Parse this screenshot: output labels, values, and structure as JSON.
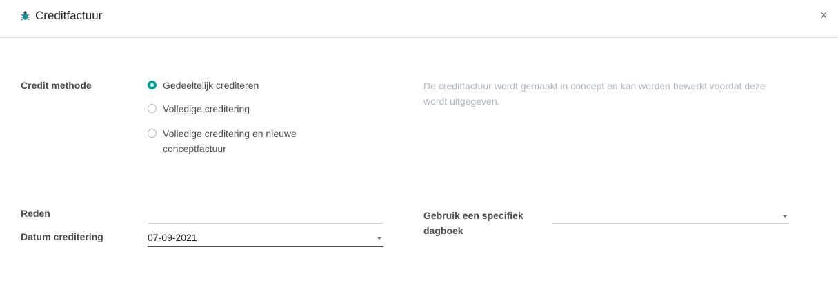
{
  "dialog": {
    "title": "Creditfactuur",
    "icon": "bug-icon",
    "close_label": "×"
  },
  "credit_method": {
    "label": "Credit methode",
    "options": [
      {
        "label": "Gedeeltelijk crediteren",
        "checked": true
      },
      {
        "label": "Volledige creditering",
        "checked": false
      },
      {
        "label": "Volledige creditering en nieuwe conceptfactuur",
        "checked": false
      }
    ],
    "help": "De creditfactuur wordt gemaakt in concept en kan worden bewerkt voordat deze wordt uitgegeven."
  },
  "fields": {
    "reason_label": "Reden",
    "reason_value": "",
    "date_label": "Datum creditering",
    "date_value": "07-09-2021",
    "journal_label": "Gebruik een specifiek dagboek",
    "journal_value": ""
  },
  "colors": {
    "accent": "#01a09d",
    "muted": "#adb5bd"
  }
}
